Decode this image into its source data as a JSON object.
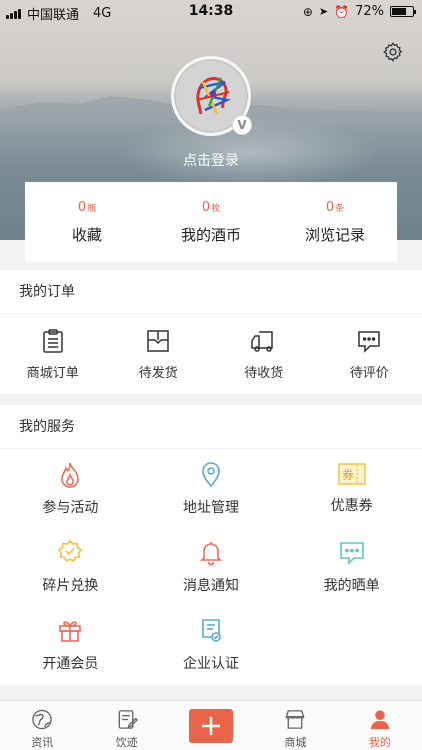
{
  "status_bar": {
    "carrier": "中国联通",
    "network": "4G",
    "time": "14:38",
    "battery_percent": "72%",
    "battery_level": 0.72
  },
  "profile": {
    "login_text": "点击登录",
    "badge": "V"
  },
  "stats": [
    {
      "count": "0",
      "unit": "瓶",
      "label": "收藏"
    },
    {
      "count": "0",
      "unit": "枚",
      "label": "我的酒币"
    },
    {
      "count": "0",
      "unit": "条",
      "label": "浏览记录"
    }
  ],
  "orders": {
    "title": "我的订单",
    "items": [
      {
        "label": "商城订单",
        "icon": "clipboard-icon"
      },
      {
        "label": "待发货",
        "icon": "package-icon"
      },
      {
        "label": "待收货",
        "icon": "truck-icon"
      },
      {
        "label": "待评价",
        "icon": "chat-bubble-icon"
      }
    ]
  },
  "services": {
    "title": "我的服务",
    "items": [
      {
        "label": "参与活动",
        "icon": "flame-icon"
      },
      {
        "label": "地址管理",
        "icon": "location-pin-icon"
      },
      {
        "label": "优惠券",
        "icon": "coupon-icon",
        "icon_text": "券"
      },
      {
        "label": "碎片兑换",
        "icon": "badge-check-icon"
      },
      {
        "label": "消息通知",
        "icon": "bell-icon"
      },
      {
        "label": "我的晒单",
        "icon": "comment-icon"
      },
      {
        "label": "开通会员",
        "icon": "gift-icon"
      },
      {
        "label": "企业认证",
        "icon": "certificate-icon"
      }
    ]
  },
  "tabbar": [
    {
      "label": "资讯",
      "icon": "globe-icon"
    },
    {
      "label": "饮迹",
      "icon": "edit-note-icon"
    },
    {
      "label": "",
      "icon": "plus-icon"
    },
    {
      "label": "商城",
      "icon": "shop-icon"
    },
    {
      "label": "我的",
      "icon": "user-icon",
      "active": true
    }
  ],
  "colors": {
    "accent": "#e8654a",
    "service_red": "#ef6b5a",
    "service_blue": "#5aa9d6",
    "service_yellow": "#f2c13a",
    "service_teal": "#5ec7c4"
  }
}
